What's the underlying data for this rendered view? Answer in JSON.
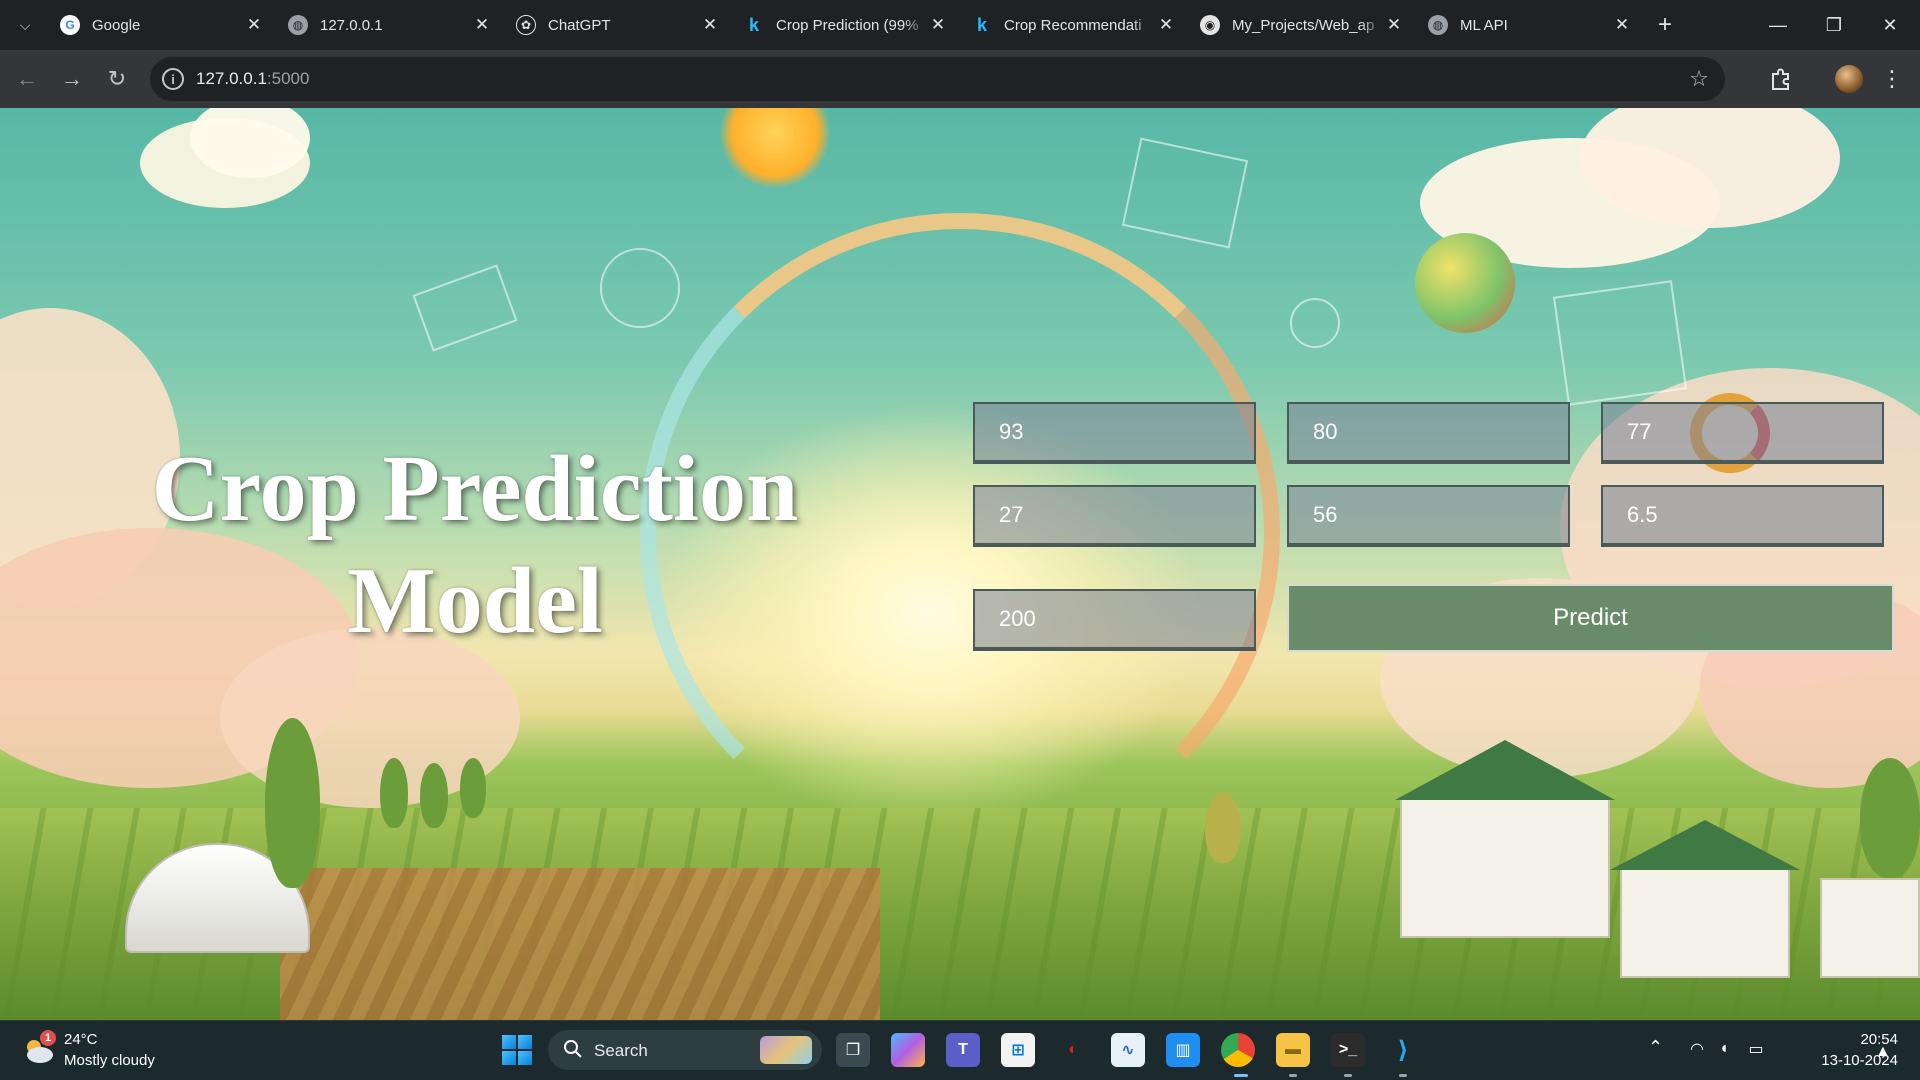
{
  "browser": {
    "tabs": [
      {
        "title": "Google",
        "favicon": "google-icon",
        "color": "#4285f4"
      },
      {
        "title": "127.0.0.1",
        "favicon": "globe-icon",
        "color": "#9aa0a6"
      },
      {
        "title": "ChatGPT",
        "favicon": "chatgpt-icon",
        "color": "#e3e3e3"
      },
      {
        "title": "Crop Prediction (99%",
        "favicon": "kaggle-icon",
        "color": "#20beff"
      },
      {
        "title": "Crop Recommendati",
        "favicon": "kaggle-icon",
        "color": "#20beff"
      },
      {
        "title": "My_Projects/Web_ap",
        "favicon": "github-icon",
        "color": "#e3e3e3"
      },
      {
        "title": "ML API",
        "favicon": "globe-icon",
        "color": "#9aa0a6"
      }
    ],
    "address": {
      "host": "127.0.0.1",
      "port": ":5000"
    }
  },
  "page": {
    "heading_line1": "Crop Prediction",
    "heading_line2": "Model",
    "inputs": [
      {
        "value": "93"
      },
      {
        "value": "80"
      },
      {
        "value": "77"
      },
      {
        "value": "27"
      },
      {
        "value": "56"
      },
      {
        "value": "6.5"
      },
      {
        "value": "200"
      }
    ],
    "predict_label": "Predict",
    "button_color": "#6a8b6a"
  },
  "taskbar": {
    "weather": {
      "temp": "24°C",
      "desc": "Mostly cloudy",
      "badge": "1"
    },
    "search_label": "Search",
    "clock": {
      "time": "20:54",
      "date": "13-10-2024"
    }
  }
}
